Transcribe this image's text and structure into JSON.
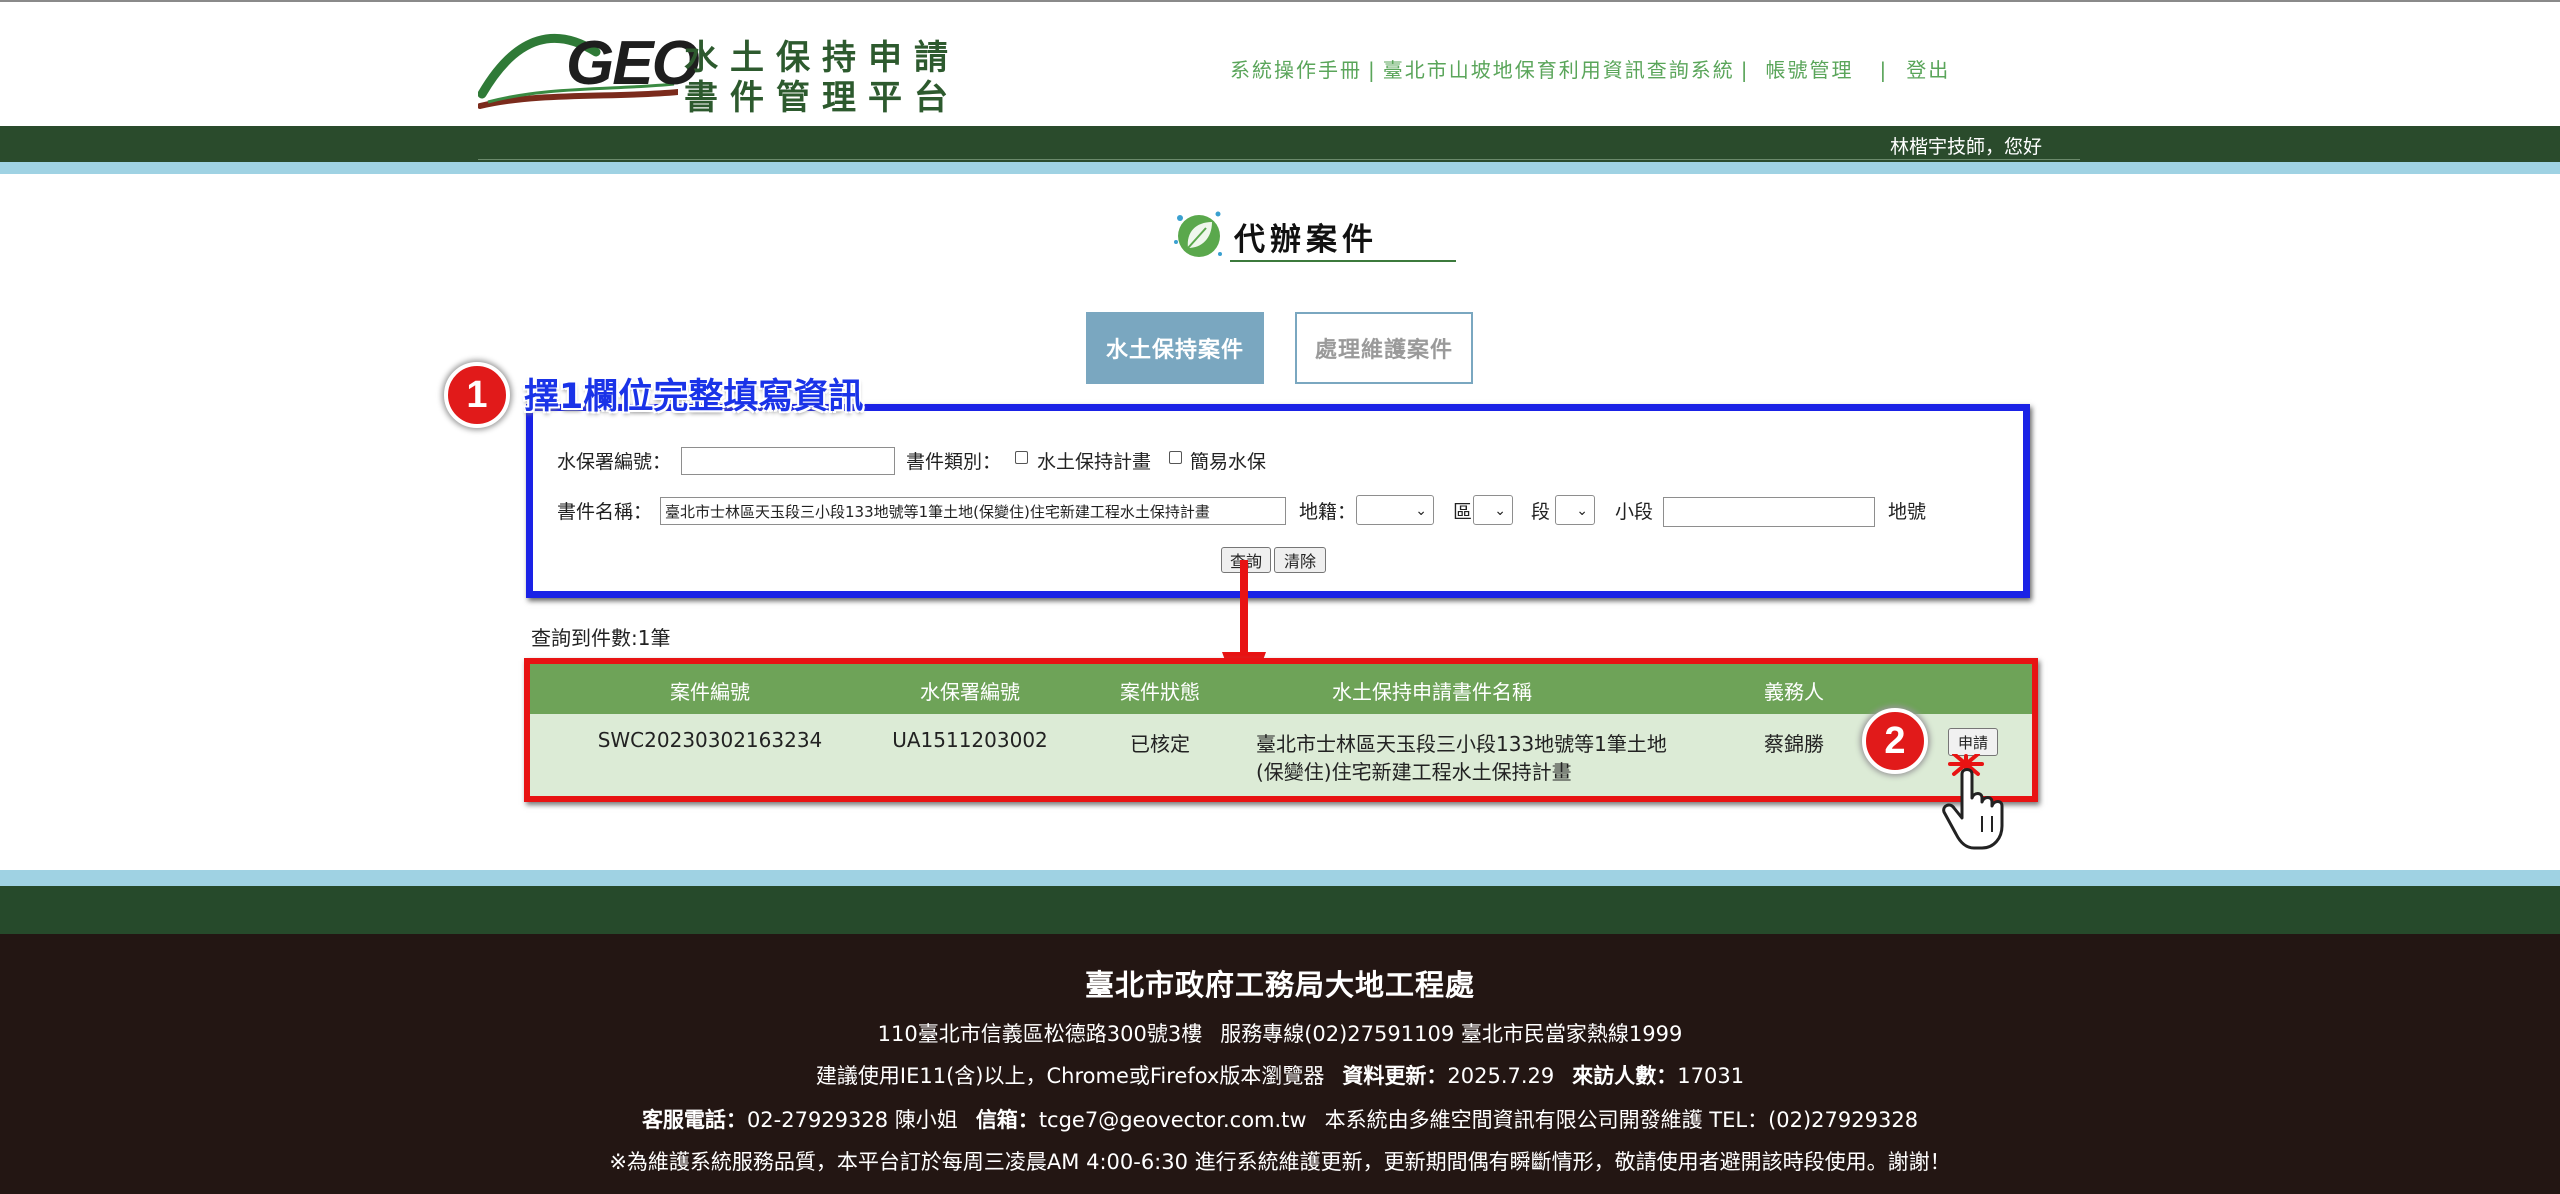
{
  "header": {
    "logo_text": "GEO",
    "platform_title_line1": "水土保持申請",
    "platform_title_line2": "書件管理平台",
    "nav": [
      {
        "label": "系統操作手冊"
      },
      {
        "label": "臺北市山坡地保育利用資訊查詢系統"
      },
      {
        "label": "帳號管理"
      },
      {
        "label": "登出"
      }
    ],
    "nav_separator": "|",
    "greeting": "林楷宇技師，您好"
  },
  "page_title": "代辦案件",
  "tabs": [
    {
      "label": "水土保持案件",
      "active": true
    },
    {
      "label": "處理維護案件",
      "active": false
    }
  ],
  "annotations": {
    "step1_number": "1",
    "step1_text": "擇1欄位完整填寫資訊",
    "step2_number": "2"
  },
  "search_form": {
    "swc_number_label": "水保署編號：",
    "swc_number_value": "",
    "doc_type_label": "書件類別：",
    "doc_type_options": [
      "水土保持計畫",
      "簡易水保"
    ],
    "doc_name_label": "書件名稱：",
    "doc_name_value": "臺北市士林區天玉段三小段133地號等1筆土地(保變住)住宅新建工程水土保持計畫",
    "land_label": "地籍：",
    "district_label": "區",
    "section_label": "段",
    "subsection_label": "小段",
    "subsection_value": "",
    "lot_label": "地號",
    "query_button": "查詢",
    "clear_button": "清除"
  },
  "result_count": "查詢到件數:1筆",
  "results_table": {
    "headers": [
      "案件編號",
      "水保署編號",
      "案件狀態",
      "水土保持申請書件名稱",
      "義務人"
    ],
    "rows": [
      {
        "case_id": "SWC20230302163234",
        "swc_id": "UA1511203002",
        "status": "已核定",
        "name_line1": "臺北市士林區天玉段三小段133地號等1筆土地",
        "name_line2": "(保變住)住宅新建工程水土保持計畫",
        "obligor": "蔡錦勝",
        "action": "申請"
      }
    ]
  },
  "footer": {
    "org": "臺北市政府工務局大地工程處",
    "address": "110臺北市信義區松德路300號3樓",
    "hotline": "服務專線(02)27591109 臺北市民當家熱線1999",
    "browser_note": "建議使用IE11(含)以上，Chrome或Firefox版本瀏覽器",
    "update_label": "資料更新：",
    "update_value": "2025.7.29",
    "visitors_label": "來訪人數：",
    "visitors_value": "17031",
    "service_phone_label": "客服電話：",
    "service_phone_value": "02-27929328 陳小姐",
    "email_label": "信箱：",
    "email_value": "tcge7@geovector.com.tw",
    "maintainer": "本系統由多維空間資訊有限公司開發維護 TEL：(02)27929328",
    "maintenance_notice": "※為維護系統服務品質，本平台訂於每周三凌晨AM 4:00-6:30 進行系統維護更新，更新期間偶有瞬斷情形，敬請使用者避開該時段使用。謝謝！"
  },
  "colors": {
    "dark_green": "#2a4b2c",
    "light_blue": "#9fd2e3",
    "tab_blue": "#7aa7c0",
    "table_header_green": "#6ea358",
    "row_green": "#dcebd6",
    "annotation_blue": "#1a22e6",
    "annotation_red": "#e81313",
    "footer_dark": "#231613"
  }
}
